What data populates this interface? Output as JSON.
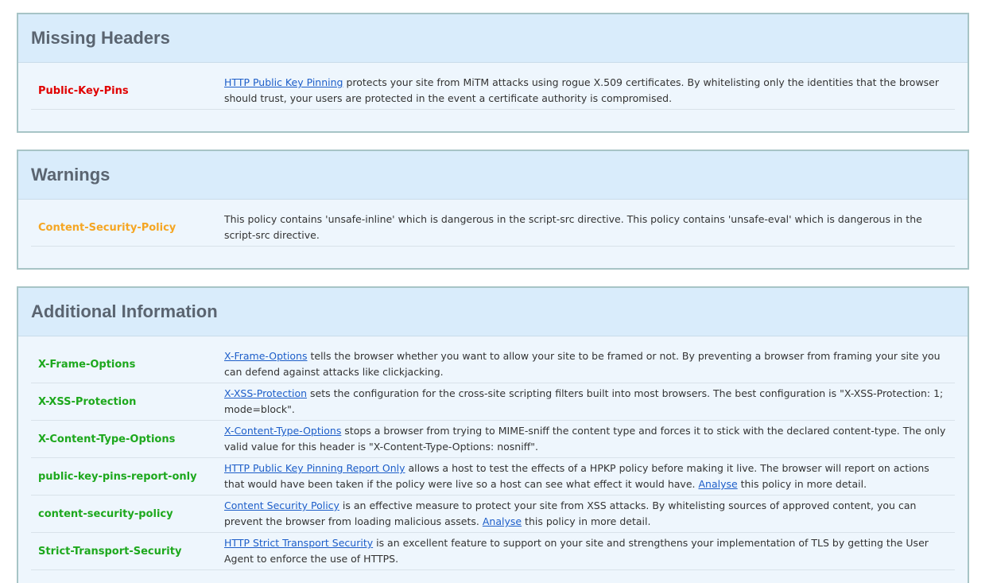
{
  "colors": {
    "missing": "#e00000",
    "warning": "#f5a623",
    "info": "#1da81d",
    "link": "#1d5ec9",
    "panel_border": "#a7c4c6",
    "panel_header_bg": "#d9ecfb"
  },
  "missing_headers": {
    "title": "Missing Headers",
    "rows": [
      {
        "name": "Public-Key-Pins",
        "link": "HTTP Public Key Pinning",
        "text": " protects your site from MiTM attacks using rogue X.509 certificates. By whitelisting only the identities that the browser should trust, your users are protected in the event a certificate authority is compromised."
      }
    ]
  },
  "warnings": {
    "title": "Warnings",
    "rows": [
      {
        "name": "Content-Security-Policy",
        "text": "This policy contains 'unsafe-inline' which is dangerous in the script-src directive. This policy contains 'unsafe-eval' which is dangerous in the script-src directive."
      }
    ]
  },
  "additional_information": {
    "title": "Additional Information",
    "rows": [
      {
        "name": "X-Frame-Options",
        "link": "X-Frame-Options",
        "text": " tells the browser whether you want to allow your site to be framed or not. By preventing a browser from framing your site you can defend against attacks like clickjacking."
      },
      {
        "name": "X-XSS-Protection",
        "link": "X-XSS-Protection",
        "text": " sets the configuration for the cross-site scripting filters built into most browsers. The best configuration is \"X-XSS-Protection: 1; mode=block\"."
      },
      {
        "name": "X-Content-Type-Options",
        "link": "X-Content-Type-Options",
        "text": " stops a browser from trying to MIME-sniff the content type and forces it to stick with the declared content-type. The only valid value for this header is \"X-Content-Type-Options: nosniff\"."
      },
      {
        "name": "public-key-pins-report-only",
        "link": "HTTP Public Key Pinning Report Only",
        "text": " allows a host to test the effects of a HPKP policy before making it live. The browser will report on actions that would have been taken if the policy were live so a host can see what effect it would have. ",
        "link2": "Analyse",
        "text2": " this policy in more detail."
      },
      {
        "name": "content-security-policy",
        "link": "Content Security Policy",
        "text": " is an effective measure to protect your site from XSS attacks. By whitelisting sources of approved content, you can prevent the browser from loading malicious assets. ",
        "link2": "Analyse",
        "text2": " this policy in more detail."
      },
      {
        "name": "Strict-Transport-Security",
        "link": "HTTP Strict Transport Security",
        "text": " is an excellent feature to support on your site and strengthens your implementation of TLS by getting the User Agent to enforce the use of HTTPS."
      }
    ]
  }
}
